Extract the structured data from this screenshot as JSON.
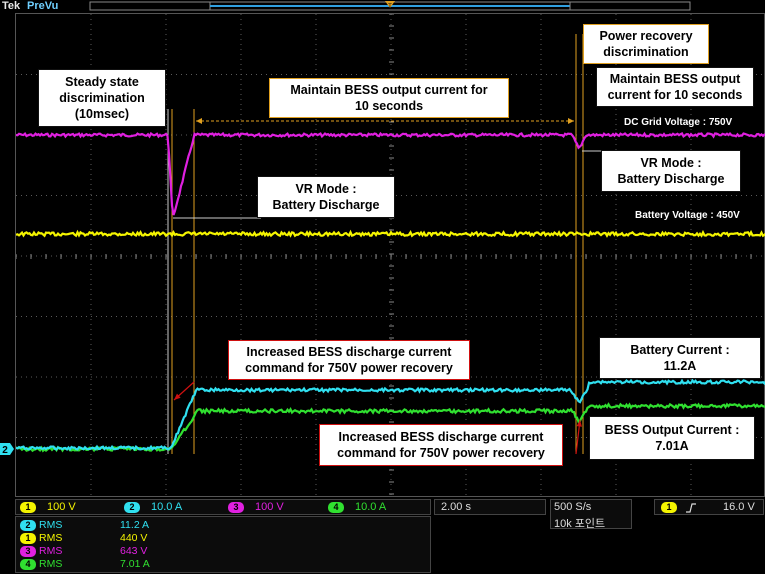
{
  "header": {
    "logo": "Tek",
    "mode": "PreVu"
  },
  "annotations": {
    "steady_state": "Steady state\ndiscrimination\n(10msec)",
    "maintain_1": "Maintain BESS output current for\n10 seconds",
    "power_recovery": "Power recovery\ndiscrimination",
    "maintain_2": "Maintain BESS output\ncurrent for 10 seconds",
    "dc_grid_voltage": "DC Grid Voltage : 750V",
    "vr_mode_2": "VR Mode :\nBattery Discharge",
    "vr_mode_1": "VR Mode :\nBattery Discharge",
    "battery_voltage": "Battery Voltage : 450V",
    "increased_1": "Increased BESS discharge current\ncommand for 750V power recovery",
    "battery_current": "Battery Current :\n11.2A",
    "increased_2": "Increased BESS discharge current\ncommand for 750V power recovery",
    "bess_output_current": "BESS Output Current :\n7.01A"
  },
  "channel_marker": "2",
  "channels": [
    {
      "num": "1",
      "scale": "100 V",
      "color": "#f4f400"
    },
    {
      "num": "2",
      "scale": "10.0 A",
      "color": "#30e0f0"
    },
    {
      "num": "3",
      "scale": "100 V",
      "color": "#e020e0"
    },
    {
      "num": "4",
      "scale": "10.0 A",
      "color": "#30e030"
    }
  ],
  "measurements": [
    {
      "num": "2",
      "type": "RMS",
      "value": "11.2 A",
      "color": "#30e0f0"
    },
    {
      "num": "1",
      "type": "RMS",
      "value": "440 V",
      "color": "#f4f400"
    },
    {
      "num": "3",
      "type": "RMS",
      "value": "643 V",
      "color": "#e020e0"
    },
    {
      "num": "4",
      "type": "RMS",
      "value": "7.01 A",
      "color": "#30e030"
    }
  ],
  "timebase": "2.00 s",
  "sample_rate": "500 S/s",
  "record_length": "10k 포인트",
  "trigger": {
    "channel": "1",
    "slope_icon": "rising-edge-icon",
    "level": "16.0 V"
  },
  "colors": {
    "ch1": "#f4f400",
    "ch2": "#30e0f0",
    "ch3": "#e020e0",
    "ch4": "#30e030",
    "grid": "#5a5a5a",
    "marker_orange": "#e0a020",
    "annotation_red": "#d01010"
  }
}
